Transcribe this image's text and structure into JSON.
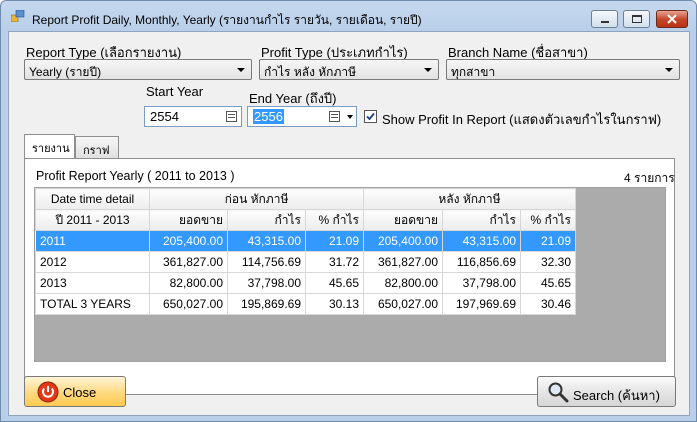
{
  "window": {
    "title": "Report Profit Daily, Monthly, Yearly (รายงานกำไร รายวัน, รายเดือน, รายปี)"
  },
  "filters": {
    "report_type_label": "Report Type (เลือกรายงาน)",
    "report_type_value": "Yearly (รายปี)",
    "profit_type_label": "Profit Type (ประเภทกำไร)",
    "profit_type_value": "กำไร หลัง หักภาษี",
    "branch_label": "Branch Name (ชื่อสาขา)",
    "branch_value": "ทุกสาขา",
    "start_year_label": "Start Year",
    "start_year_value": "2554",
    "end_year_label": "End Year (ถึงปี)",
    "end_year_value": "2556",
    "show_profit_label": "Show Profit In Report (แสดงตัวเลขกำไรในกราฟ)",
    "show_profit_checked": true
  },
  "tabs": [
    {
      "label": "รายงาน",
      "active": true
    },
    {
      "label": "กราฟ",
      "active": false
    }
  ],
  "report": {
    "heading": "Profit Report Yearly ( 2011 to 2013 )",
    "count": "4 รายการ",
    "group_headers": [
      "Date time detail",
      "ก่อน หักภาษี",
      "หลัง หักภาษี"
    ],
    "columns": [
      "ปี 2011 - 2013",
      "ยอดขาย",
      "กำไร",
      "% กำไร",
      "ยอดขาย",
      "กำไร",
      "% กำไร"
    ],
    "rows": [
      [
        "2011",
        "205,400.00",
        "43,315.00",
        "21.09",
        "205,400.00",
        "43,315.00",
        "21.09"
      ],
      [
        "2012",
        "361,827.00",
        "114,756.69",
        "31.72",
        "361,827.00",
        "116,856.69",
        "32.30"
      ],
      [
        "2013",
        "82,800.00",
        "37,798.00",
        "45.65",
        "82,800.00",
        "37,798.00",
        "45.65"
      ],
      [
        "TOTAL 3 YEARS",
        "650,027.00",
        "195,869.69",
        "30.13",
        "650,027.00",
        "197,969.69",
        "30.46"
      ]
    ]
  },
  "buttons": {
    "close_label": "Close",
    "search_label": "Search (ค้นหา)"
  }
}
